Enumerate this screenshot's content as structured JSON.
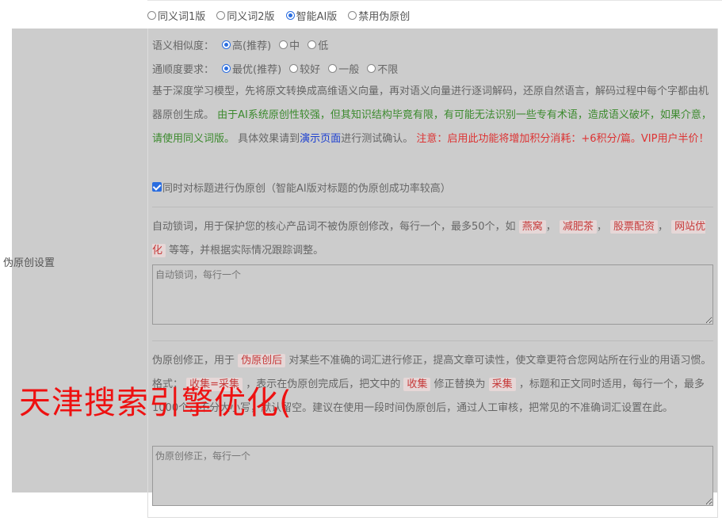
{
  "mode_options": [
    {
      "label": "同义词1版",
      "checked": false
    },
    {
      "label": "同义词2版",
      "checked": false
    },
    {
      "label": "智能AI版",
      "checked": true
    },
    {
      "label": "禁用伪原创",
      "checked": false
    }
  ],
  "left_label": "伪原创设置",
  "similarity": {
    "label": "语义相似度：",
    "options": [
      {
        "label": "高(推荐)",
        "checked": true
      },
      {
        "label": "中",
        "checked": false
      },
      {
        "label": "低",
        "checked": false
      }
    ]
  },
  "fluency": {
    "label": "通顺度要求：",
    "options": [
      {
        "label": "最优(推荐)",
        "checked": true
      },
      {
        "label": "较好",
        "checked": false
      },
      {
        "label": "一般",
        "checked": false
      },
      {
        "label": "不限",
        "checked": false
      }
    ]
  },
  "ai_desc": {
    "t1": "基于深度学习模型，先将原文转换成高维语义向量，再对语义向量进行逐词解码，还原自然语言，解码过程中每个字都由机器原创生成。",
    "t2": "由于AI系统原创性较强，但其知识结构毕竟有限，有可能无法识别一些专有术语，造成语义破坏，如果介意，请使用同义词版。",
    "t3": "具体效果请到",
    "link": "演示页面",
    "t4": "进行测试确认。",
    "t5": "注意：启用此功能将增加积分消耗：+6积分/篇。VIP用户半价！"
  },
  "title_check": {
    "label": "同时对标题进行伪原创（智能AI版对标题的伪原创成功率较高）",
    "checked": true
  },
  "lock": {
    "t1": "自动锁词，用于保护您的核心产品词不被伪原创修改，每行一个，最多50个，如",
    "chips": [
      "燕窝",
      "减肥茶",
      "股票配资",
      "网站优化"
    ],
    "t2": "等等，并根据实际情况跟踪调整。",
    "placeholder": "自动锁词，每行一个"
  },
  "fix": {
    "t1": "伪原创修正，用于",
    "chip1": "伪原创后",
    "t2": "对某些不准确的词汇进行修正，提高文章可读性，使文章更符合您网站所在行业的用语习惯。格式：",
    "chip2": "收集=采集",
    "t3": "，表示在伪原创完成后，把文中的",
    "chip3": "收集",
    "t4": "修正替换为",
    "chip4": "采集",
    "t5": "，标题和正文同时适用，每行一个，最多1000个，不分大小写，默认留空。建议在使用一段时间伪原创后，通过人工审核，把常见的不准确词汇设置在此。",
    "placeholder": "伪原创修正，每行一个"
  },
  "watermark": "天津搜索引擎优化("
}
